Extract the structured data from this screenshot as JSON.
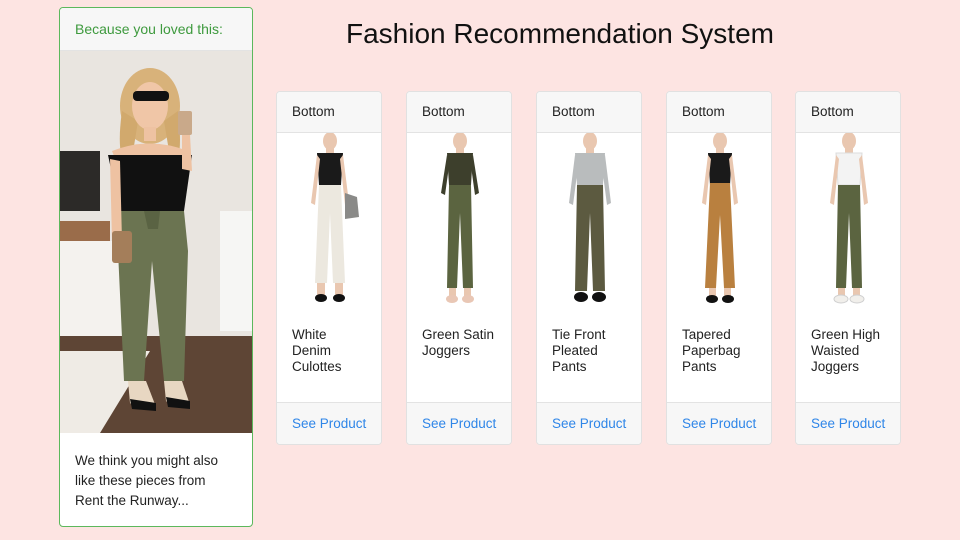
{
  "page": {
    "title": "Fashion Recommendation System"
  },
  "hero": {
    "header": "Because you loved this:",
    "description": "We think you might also like these pieces from Rent the Runway..."
  },
  "products": [
    {
      "category": "Bottom",
      "name": "White Denim Culottes",
      "action": "See Product",
      "top_color": "#1a1a1a",
      "bottom_color": "#ece8df",
      "shoe_color": "#111111"
    },
    {
      "category": "Bottom",
      "name": "Green Satin Joggers",
      "action": "See Product",
      "top_color": "#3d3f2c",
      "bottom_color": "#5b6440",
      "shoe_color": "#e9c7b5"
    },
    {
      "category": "Bottom",
      "name": "Tie Front Pleated Pants",
      "action": "See Product",
      "top_color": "#b9bcbd",
      "bottom_color": "#5c5a40",
      "shoe_color": "#111111"
    },
    {
      "category": "Bottom",
      "name": "Tapered Paperbag Pants",
      "action": "See Product",
      "top_color": "#1a1a1a",
      "bottom_color": "#b9803f",
      "shoe_color": "#111111"
    },
    {
      "category": "Bottom",
      "name": "Green High Waisted Joggers",
      "action": "See Product",
      "top_color": "#f3f3f3",
      "bottom_color": "#5b6440",
      "shoe_color": "#f1efeb"
    }
  ],
  "colors": {
    "background": "#fde4e2",
    "hero_border": "#5cb85c",
    "hero_header_text": "#3e9a3e",
    "link": "#2f86e8"
  }
}
